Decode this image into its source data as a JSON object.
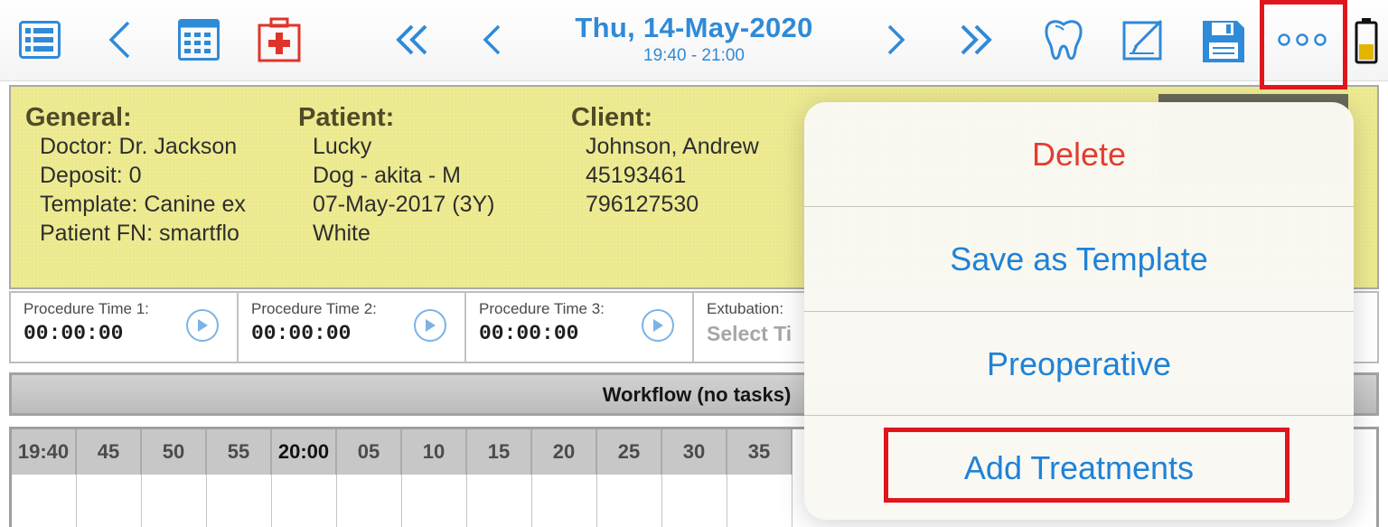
{
  "toolbar": {
    "date": "Thu, 14-May-2020",
    "time_range": "19:40 - 21:00",
    "icons": [
      "list-icon",
      "back-chevron-icon",
      "calendar-grid-icon",
      "medical-kit-icon",
      "double-chevron-left-icon",
      "chevron-left-icon",
      "chevron-right-icon",
      "double-chevron-right-icon",
      "tooth-icon",
      "edit-note-icon",
      "save-disk-icon",
      "more-dots-icon",
      "battery-icon"
    ]
  },
  "general": {
    "heading": "General:",
    "lines": [
      "Doctor: Dr. Jackson",
      "Deposit: 0",
      "Template: Canine ex",
      "Patient FN: smartflo"
    ]
  },
  "patient": {
    "heading": "Patient:",
    "lines": [
      "Lucky",
      "Dog - akita - M",
      "07-May-2017 (3Y)",
      "White"
    ]
  },
  "client": {
    "heading": "Client:",
    "lines": [
      "Johnson, Andrew",
      "45193461",
      "796127530"
    ]
  },
  "timers": [
    {
      "label": "Procedure Time 1:",
      "value": "00:00:00"
    },
    {
      "label": "Procedure Time 2:",
      "value": "00:00:00"
    },
    {
      "label": "Procedure Time 3:",
      "value": "00:00:00"
    },
    {
      "label": "Extubation:",
      "value": "Select Ti"
    }
  ],
  "workflow": {
    "label": "Workflow (no tasks)"
  },
  "timeline": {
    "ticks": [
      "19:40",
      "45",
      "50",
      "55",
      "20:00",
      "05",
      "10",
      "15",
      "20",
      "25",
      "30",
      "35"
    ]
  },
  "menu": {
    "delete": "Delete",
    "save_template": "Save as Template",
    "preoperative": "Preoperative",
    "add_treatments": "Add Treatments"
  },
  "colors": {
    "accent": "#2f8ad8",
    "destructive": "#e23d30",
    "panel": "#ece98d",
    "highlight": "#e0161e",
    "medical_red": "#e0342a",
    "battery": "#e3b400"
  }
}
